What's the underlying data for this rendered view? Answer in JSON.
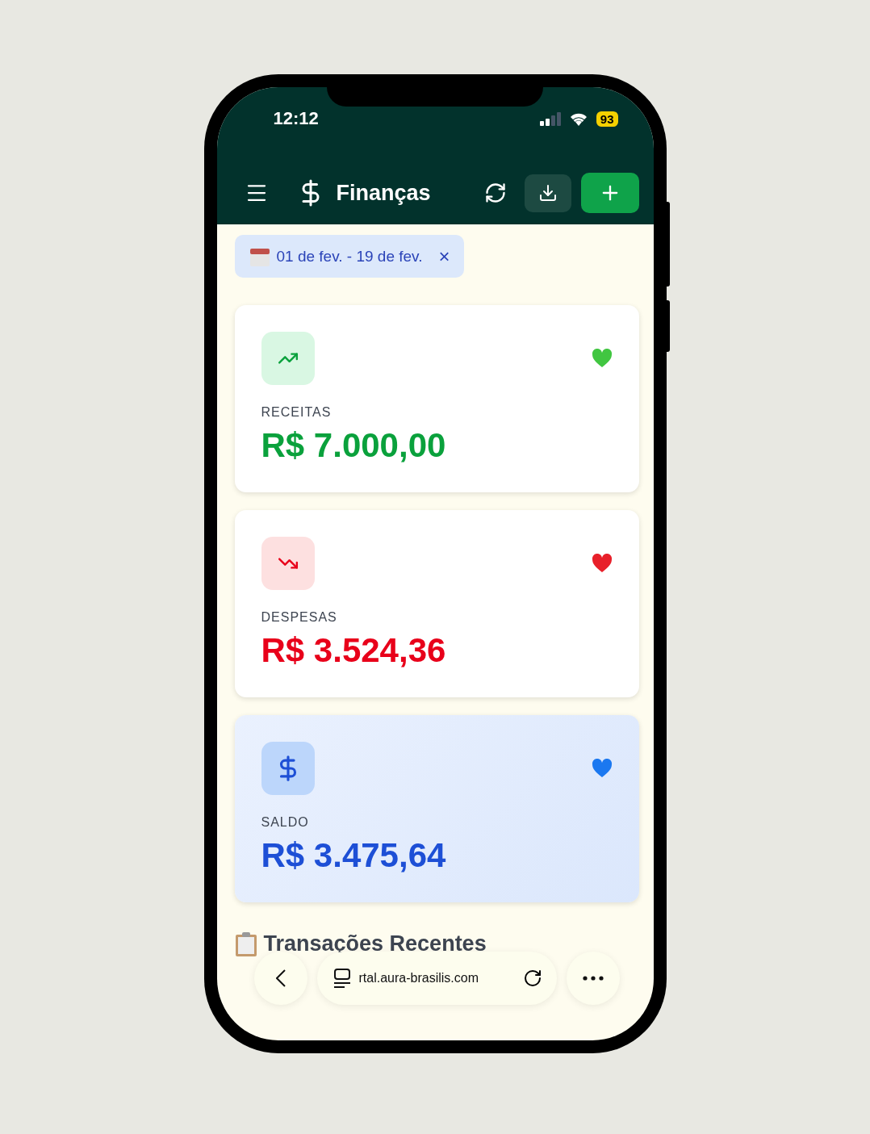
{
  "status_bar": {
    "time": "12:12",
    "battery": "93"
  },
  "header": {
    "title": "Finanças"
  },
  "date_filter": {
    "label": "01 de fev. - 19 de fev.",
    "close": "×"
  },
  "cards": [
    {
      "kind": "income",
      "label": "RECEITAS",
      "amount": "R$ 7.000,00"
    },
    {
      "kind": "expense",
      "label": "DESPESAS",
      "amount": "R$ 3.524,36"
    },
    {
      "kind": "balance",
      "label": "SALDO",
      "amount": "R$ 3.475,64"
    }
  ],
  "section": {
    "title": "Transações Recentes"
  },
  "browser_bar": {
    "url": "rtal.aura-brasilis.com"
  }
}
